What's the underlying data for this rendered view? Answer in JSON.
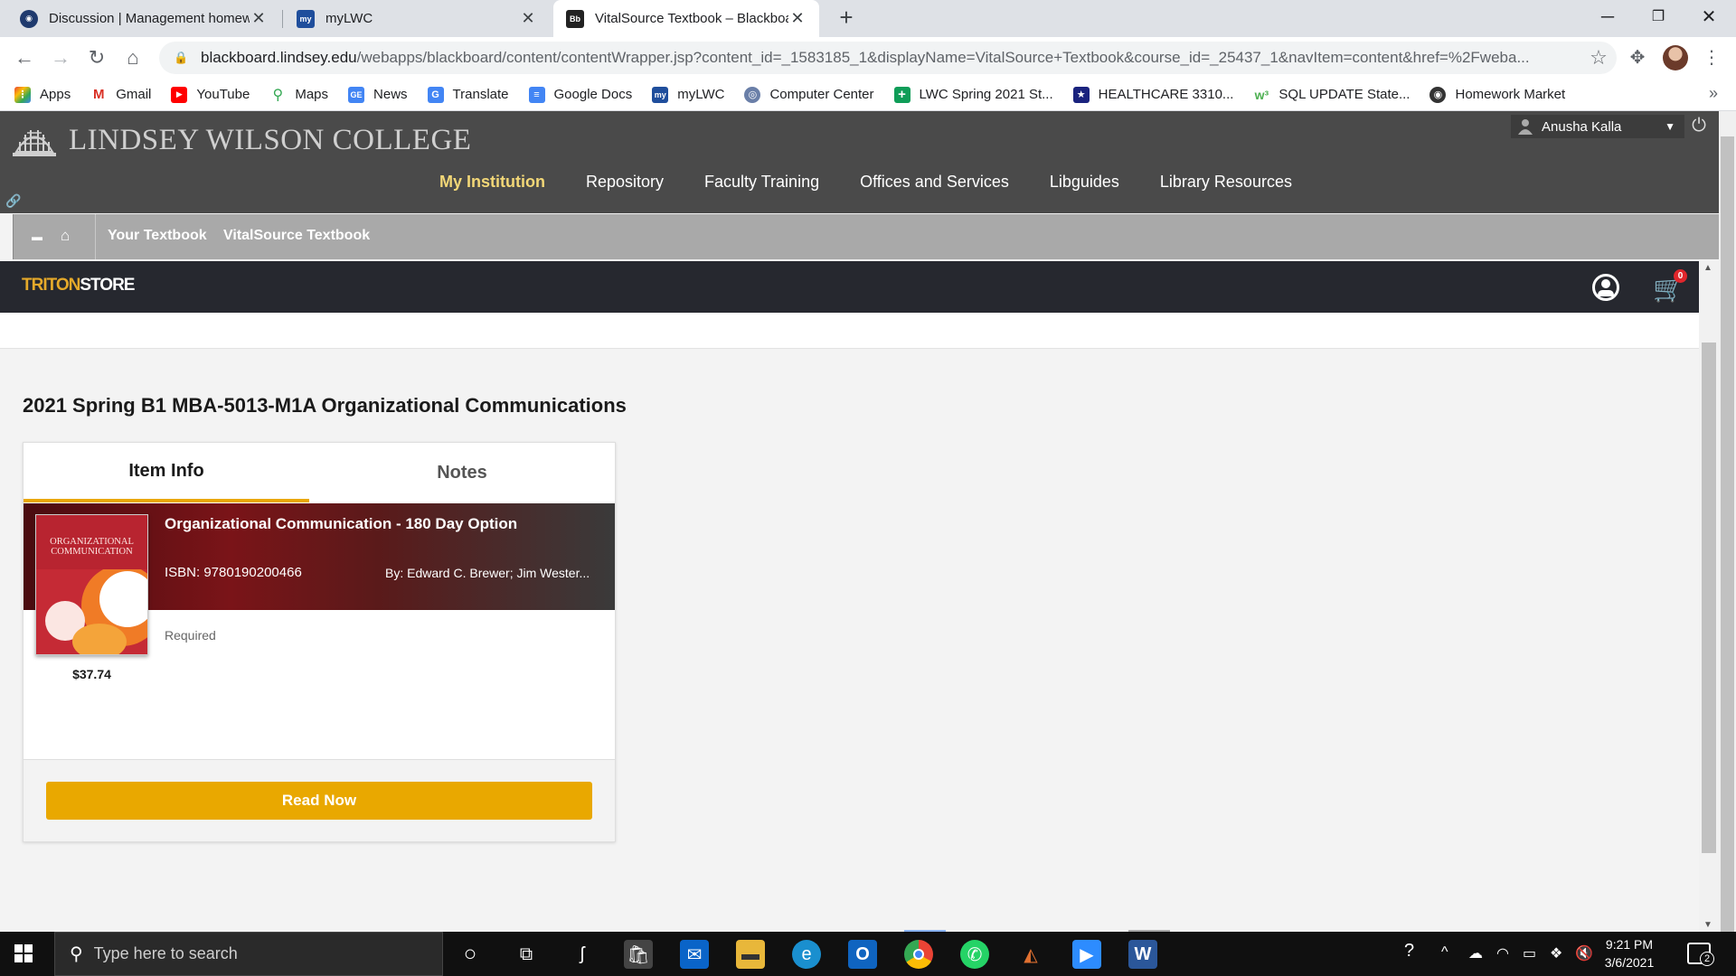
{
  "browser": {
    "tabs": [
      {
        "title": "Discussion | Management homew",
        "icon": "blackboard-icon"
      },
      {
        "title": "myLWC",
        "icon": "mylwc-icon"
      },
      {
        "title": "VitalSource Textbook – Blackboar",
        "icon": "bb-icon",
        "active": true
      }
    ],
    "url_domain": "blackboard.lindsey.edu",
    "url_path": "/webapps/blackboard/content/contentWrapper.jsp?content_id=_1583185_1&displayName=VitalSource+Textbook&course_id=_25437_1&navItem=content&href=%2Fweba...",
    "bookmarks": [
      {
        "label": "Apps",
        "icon": "apps-grid-icon",
        "color": "#ea4335"
      },
      {
        "label": "Gmail",
        "icon": "gmail-icon",
        "color": "#d93025"
      },
      {
        "label": "YouTube",
        "icon": "youtube-icon",
        "color": "#ff0000"
      },
      {
        "label": "Maps",
        "icon": "maps-pin-icon",
        "color": "#34a853"
      },
      {
        "label": "News",
        "icon": "news-icon",
        "color": "#4285f4"
      },
      {
        "label": "Translate",
        "icon": "translate-icon",
        "color": "#4285f4"
      },
      {
        "label": "Google Docs",
        "icon": "docs-icon",
        "color": "#4285f4"
      },
      {
        "label": "myLWC",
        "icon": "mylwc-icon",
        "color": "#1f4e9c"
      },
      {
        "label": "Computer Center",
        "icon": "computer-center-icon",
        "color": "#6a7fa8"
      },
      {
        "label": "LWC Spring 2021 St...",
        "icon": "sheets-icon",
        "color": "#0f9d58"
      },
      {
        "label": "HEALTHCARE 3310...",
        "icon": "star-badge-icon",
        "color": "#1a237e"
      },
      {
        "label": "SQL UPDATE State...",
        "icon": "w3-icon",
        "color": "#4caf50"
      },
      {
        "label": "Homework Market",
        "icon": "homework-market-icon",
        "color": "#333333"
      }
    ]
  },
  "blackboard": {
    "college_name": "LINDSEY WILSON COLLEGE",
    "user_name": "Anusha Kalla",
    "nav": [
      {
        "label": "My Institution",
        "active": true
      },
      {
        "label": "Repository"
      },
      {
        "label": "Faculty Training"
      },
      {
        "label": "Offices and Services"
      },
      {
        "label": "Libguides"
      },
      {
        "label": "Library Resources"
      }
    ],
    "breadcrumb": [
      "Your Textbook",
      "VitalSource Textbook"
    ]
  },
  "store": {
    "logo_part1": "TRITON",
    "logo_part2": "STORE",
    "cart_count": "0",
    "course_title": "2021 Spring B1 MBA-5013-M1A Organizational Communications",
    "tabs": [
      "Item Info",
      "Notes"
    ],
    "item": {
      "title": "Organizational Communication - 180 Day Option",
      "isbn": "ISBN: 9780190200466",
      "authors": "By: Edward C. Brewer; Jim Wester...",
      "requirement": "Required",
      "price": "$37.74",
      "cover_title": "ORGANIZATIONAL COMMUNICATION"
    },
    "read_button": "Read Now",
    "accent": "#e9a800"
  },
  "taskbar": {
    "search_placeholder": "Type here to search",
    "time": "9:21 PM",
    "date": "3/6/2021",
    "notifications": "2"
  }
}
